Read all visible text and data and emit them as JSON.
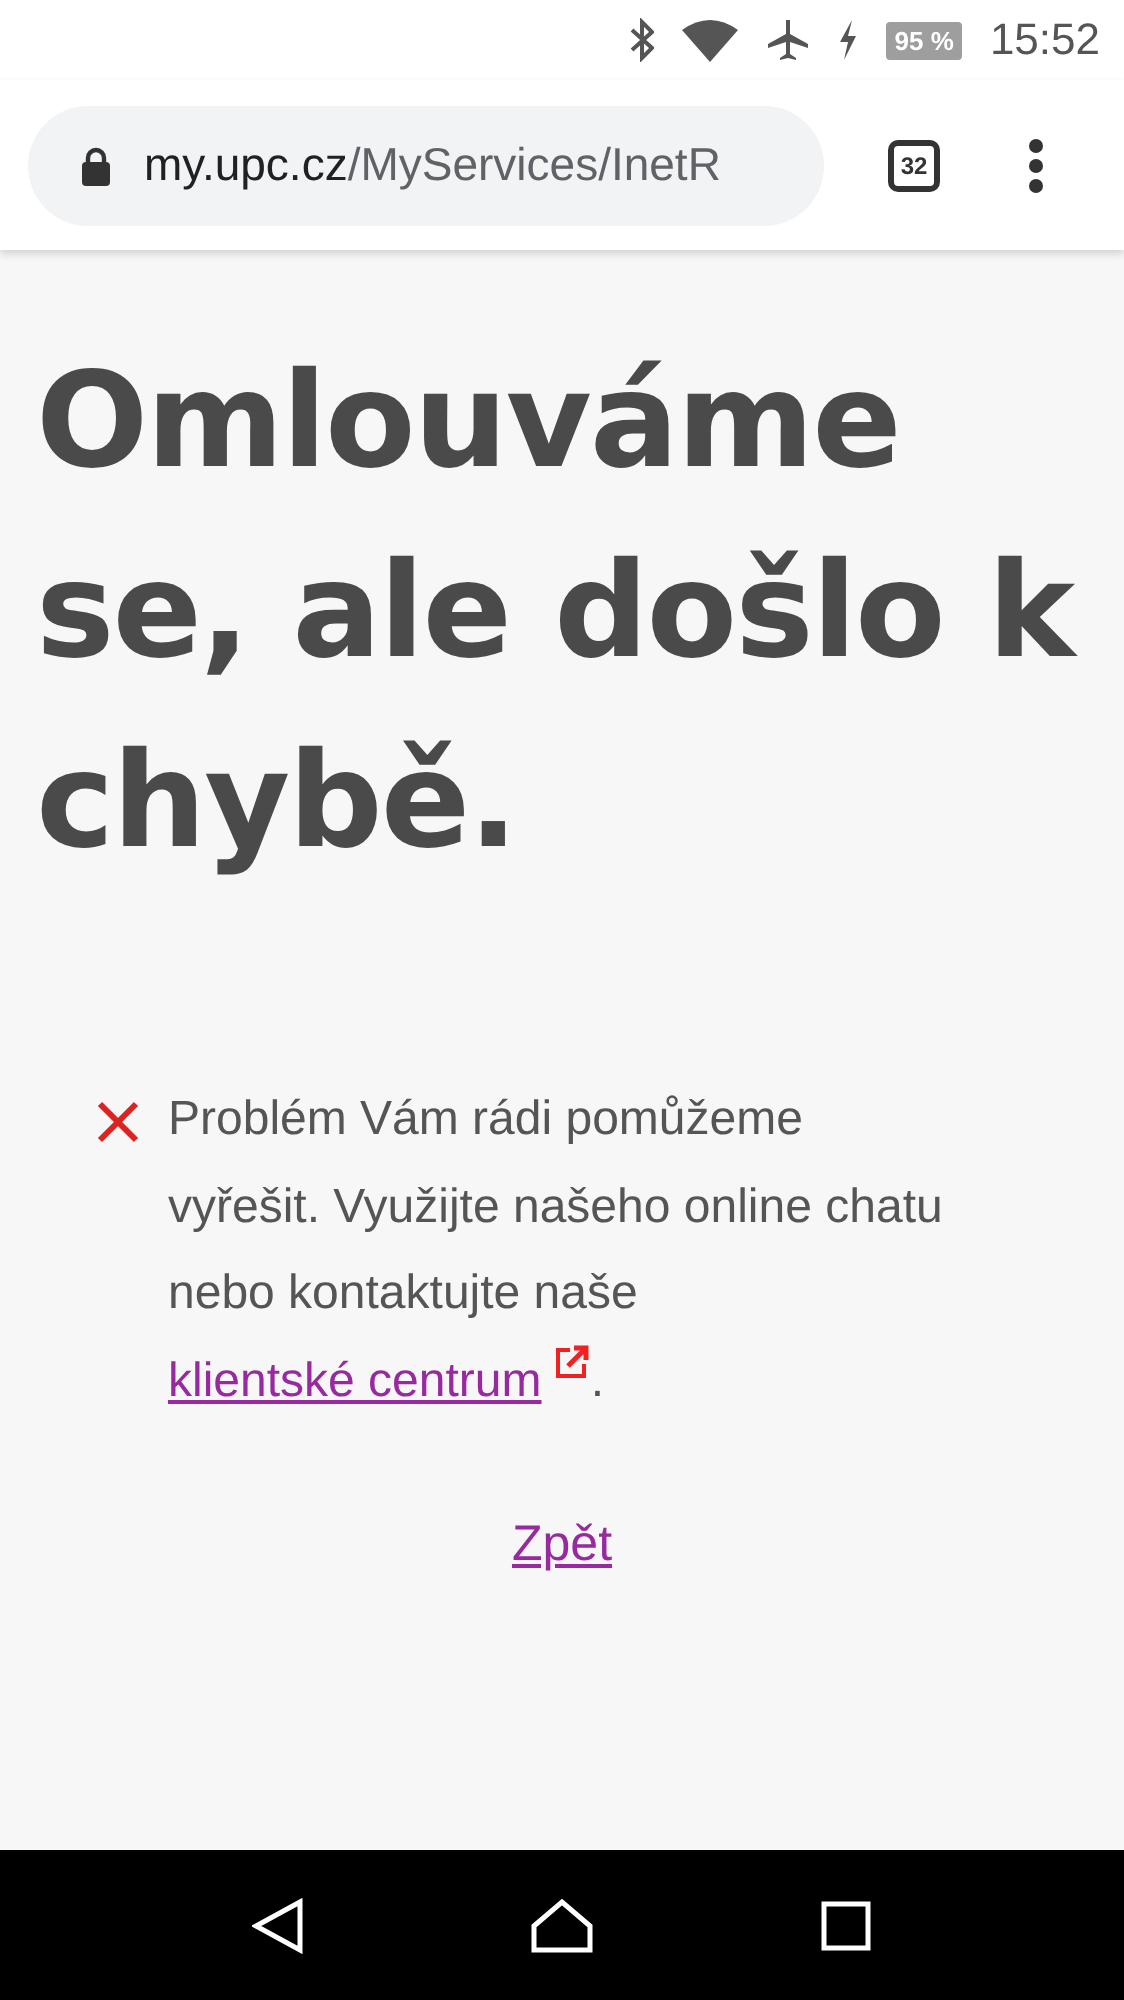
{
  "status_bar": {
    "battery": "95 %",
    "time": "15:52"
  },
  "browser": {
    "url_host": "my.upc.cz",
    "url_path": "/MyServices/InetR",
    "tab_count": "32"
  },
  "page": {
    "heading": "Omlouváme se, ale došlo k chybě.",
    "message": {
      "text": "Problém Vám rádi pomůžeme vyřešit. Využijte našeho online chatu nebo kontaktujte naše ",
      "link": "klientské centrum",
      "end": "."
    },
    "back_link": "Zpět"
  }
}
